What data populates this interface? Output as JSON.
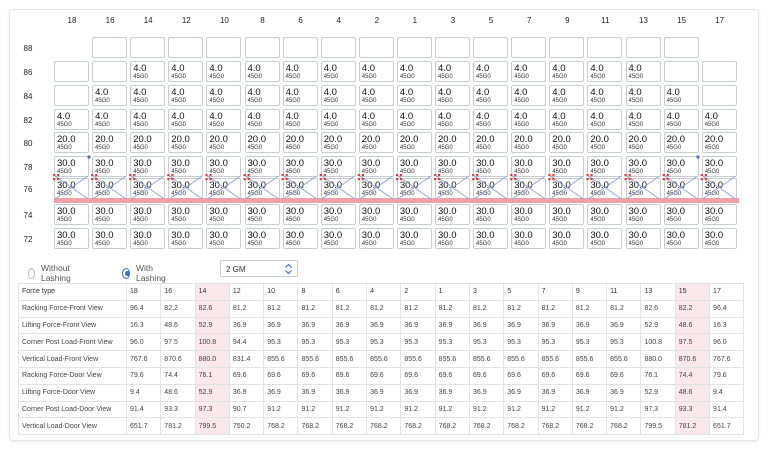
{
  "columns": [
    "18",
    "16",
    "14",
    "12",
    "10",
    "8",
    "6",
    "4",
    "2",
    "1",
    "3",
    "5",
    "7",
    "9",
    "11",
    "13",
    "15",
    "17"
  ],
  "tiers": [
    {
      "label": "88",
      "cells": [
        null,
        "",
        "",
        "",
        "",
        "",
        "",
        "",
        "",
        "",
        "",
        "",
        "",
        "",
        "",
        "",
        "",
        null
      ]
    },
    {
      "label": "86",
      "cells": [
        "",
        "",
        {
          "w": "4.0",
          "c": "45G0"
        },
        {
          "w": "4.0",
          "c": "45G0"
        },
        {
          "w": "4.0",
          "c": "45G0"
        },
        {
          "w": "4.0",
          "c": "45G0"
        },
        {
          "w": "4.0",
          "c": "45G0"
        },
        {
          "w": "4.0",
          "c": "45G0"
        },
        {
          "w": "4.0",
          "c": "45G0"
        },
        {
          "w": "4.0",
          "c": "45G0"
        },
        {
          "w": "4.0",
          "c": "45G0"
        },
        {
          "w": "4.0",
          "c": "45G0"
        },
        {
          "w": "4.0",
          "c": "45G0"
        },
        {
          "w": "4.0",
          "c": "45G0"
        },
        {
          "w": "4.0",
          "c": "45G0"
        },
        {
          "w": "4.0",
          "c": "45G0"
        },
        "",
        ""
      ]
    },
    {
      "label": "84",
      "cells": [
        "",
        {
          "w": "4.0",
          "c": "45G0"
        },
        {
          "w": "4.0",
          "c": "45G0"
        },
        {
          "w": "4.0",
          "c": "45G0"
        },
        {
          "w": "4.0",
          "c": "45G0"
        },
        {
          "w": "4.0",
          "c": "45G0"
        },
        {
          "w": "4.0",
          "c": "45G0"
        },
        {
          "w": "4.0",
          "c": "45G0"
        },
        {
          "w": "4.0",
          "c": "45G0"
        },
        {
          "w": "4.0",
          "c": "45G0"
        },
        {
          "w": "4.0",
          "c": "45G0"
        },
        {
          "w": "4.0",
          "c": "45G0"
        },
        {
          "w": "4.0",
          "c": "45G0"
        },
        {
          "w": "4.0",
          "c": "45G0"
        },
        {
          "w": "4.0",
          "c": "45G0"
        },
        {
          "w": "4.0",
          "c": "45G0"
        },
        {
          "w": "4.0",
          "c": "45G0"
        },
        ""
      ]
    },
    {
      "label": "82",
      "cells": [
        {
          "w": "4.0",
          "c": "45G0"
        },
        {
          "w": "4.0",
          "c": "45G0"
        },
        {
          "w": "4.0",
          "c": "45G0"
        },
        {
          "w": "4.0",
          "c": "45G0"
        },
        {
          "w": "4.0",
          "c": "45G0"
        },
        {
          "w": "4.0",
          "c": "45G0"
        },
        {
          "w": "4.0",
          "c": "45G0"
        },
        {
          "w": "4.0",
          "c": "45G0"
        },
        {
          "w": "4.0",
          "c": "45G0"
        },
        {
          "w": "4.0",
          "c": "45G0"
        },
        {
          "w": "4.0",
          "c": "45G0"
        },
        {
          "w": "4.0",
          "c": "45G0"
        },
        {
          "w": "4.0",
          "c": "45G0"
        },
        {
          "w": "4.0",
          "c": "45G0"
        },
        {
          "w": "4.0",
          "c": "45G0"
        },
        {
          "w": "4.0",
          "c": "45G0"
        },
        {
          "w": "4.0",
          "c": "45G0"
        },
        {
          "w": "4.0",
          "c": "45G0"
        }
      ]
    },
    {
      "label": "80",
      "cells": [
        {
          "w": "20.0",
          "c": "45G0"
        },
        {
          "w": "20.0",
          "c": "45G0"
        },
        {
          "w": "20.0",
          "c": "45G0"
        },
        {
          "w": "20.0",
          "c": "45G0"
        },
        {
          "w": "20.0",
          "c": "45G0"
        },
        {
          "w": "20.0",
          "c": "45G0"
        },
        {
          "w": "20.0",
          "c": "45G0"
        },
        {
          "w": "20.0",
          "c": "45G0"
        },
        {
          "w": "20.0",
          "c": "45G0"
        },
        {
          "w": "20.0",
          "c": "45G0"
        },
        {
          "w": "20.0",
          "c": "45G0"
        },
        {
          "w": "20.0",
          "c": "45G0"
        },
        {
          "w": "20.0",
          "c": "45G0"
        },
        {
          "w": "20.0",
          "c": "45G0"
        },
        {
          "w": "20.0",
          "c": "45G0"
        },
        {
          "w": "20.0",
          "c": "45G0"
        },
        {
          "w": "20.0",
          "c": "45G0"
        },
        {
          "w": "20.0",
          "c": "45G0"
        }
      ]
    },
    {
      "label": "78",
      "cells": [
        {
          "w": "30.0",
          "c": "45G0"
        },
        {
          "w": "30.0",
          "c": "45G0"
        },
        {
          "w": "30.0",
          "c": "45G0"
        },
        {
          "w": "30.0",
          "c": "45G0"
        },
        {
          "w": "30.0",
          "c": "45G0"
        },
        {
          "w": "30.0",
          "c": "45G0"
        },
        {
          "w": "30.0",
          "c": "45G0"
        },
        {
          "w": "30.0",
          "c": "45G0"
        },
        {
          "w": "30.0",
          "c": "45G0"
        },
        {
          "w": "30.0",
          "c": "45G0"
        },
        {
          "w": "30.0",
          "c": "45G0"
        },
        {
          "w": "30.0",
          "c": "45G0"
        },
        {
          "w": "30.0",
          "c": "45G0"
        },
        {
          "w": "30.0",
          "c": "45G0"
        },
        {
          "w": "30.0",
          "c": "45G0"
        },
        {
          "w": "30.0",
          "c": "45G0"
        },
        {
          "w": "30.0",
          "c": "45G0"
        },
        {
          "w": "30.0",
          "c": "45G0"
        }
      ]
    },
    {
      "label": "76",
      "cells": [
        {
          "w": "30.0",
          "c": "45G0"
        },
        {
          "w": "30.0",
          "c": "45G0"
        },
        {
          "w": "30.0",
          "c": "45G0"
        },
        {
          "w": "30.0",
          "c": "45G0"
        },
        {
          "w": "30.0",
          "c": "45G0"
        },
        {
          "w": "30.0",
          "c": "45G0"
        },
        {
          "w": "30.0",
          "c": "45G0"
        },
        {
          "w": "30.0",
          "c": "45G0"
        },
        {
          "w": "30.0",
          "c": "45G0"
        },
        {
          "w": "30.0",
          "c": "45G0"
        },
        {
          "w": "30.0",
          "c": "45G0"
        },
        {
          "w": "30.0",
          "c": "45G0"
        },
        {
          "w": "30.0",
          "c": "45G0"
        },
        {
          "w": "30.0",
          "c": "45G0"
        },
        {
          "w": "30.0",
          "c": "45G0"
        },
        {
          "w": "30.0",
          "c": "45G0"
        },
        {
          "w": "30.0",
          "c": "45G0"
        },
        {
          "w": "30.0",
          "c": "45G0"
        }
      ]
    },
    {
      "label": "74",
      "cells": [
        {
          "w": "30.0",
          "c": "45G0"
        },
        {
          "w": "30.0",
          "c": "45G0"
        },
        {
          "w": "30.0",
          "c": "45G0"
        },
        {
          "w": "30.0",
          "c": "45G0"
        },
        {
          "w": "30.0",
          "c": "45G0"
        },
        {
          "w": "30.0",
          "c": "45G0"
        },
        {
          "w": "30.0",
          "c": "45G0"
        },
        {
          "w": "30.0",
          "c": "45G0"
        },
        {
          "w": "30.0",
          "c": "45G0"
        },
        {
          "w": "30.0",
          "c": "45G0"
        },
        {
          "w": "30.0",
          "c": "45G0"
        },
        {
          "w": "30.0",
          "c": "45G0"
        },
        {
          "w": "30.0",
          "c": "45G0"
        },
        {
          "w": "30.0",
          "c": "45G0"
        },
        {
          "w": "30.0",
          "c": "45G0"
        },
        {
          "w": "30.0",
          "c": "45G0"
        },
        {
          "w": "30.0",
          "c": "45G0"
        },
        {
          "w": "30.0",
          "c": "45G0"
        }
      ]
    },
    {
      "label": "72",
      "cells": [
        {
          "w": "30.0",
          "c": "45G0"
        },
        {
          "w": "30.0",
          "c": "45G0"
        },
        {
          "w": "30.0",
          "c": "45G0"
        },
        {
          "w": "30.0",
          "c": "45G0"
        },
        {
          "w": "30.0",
          "c": "45G0"
        },
        {
          "w": "30.0",
          "c": "45G0"
        },
        {
          "w": "30.0",
          "c": "45G0"
        },
        {
          "w": "30.0",
          "c": "45G0"
        },
        {
          "w": "30.0",
          "c": "45G0"
        },
        {
          "w": "30.0",
          "c": "45G0"
        },
        {
          "w": "30.0",
          "c": "45G0"
        },
        {
          "w": "30.0",
          "c": "45G0"
        },
        {
          "w": "30.0",
          "c": "45G0"
        },
        {
          "w": "30.0",
          "c": "45G0"
        },
        {
          "w": "30.0",
          "c": "45G0"
        },
        {
          "w": "30.0",
          "c": "45G0"
        },
        {
          "w": "30.0",
          "c": "45G0"
        },
        {
          "w": "30.0",
          "c": "45G0"
        }
      ]
    }
  ],
  "lashing_colors": {
    "bar": "#f0a0a8",
    "rod": "#8fa6d8",
    "marker": "#e23a3a",
    "accent": "#3b73c4",
    "highlight": "#fbe8ea"
  },
  "controls": {
    "without_lashing_label": "Without Lashing",
    "with_lashing_label": "With Lashing",
    "selected_mode": "with_lashing",
    "gm_value": "2 GM"
  },
  "force_table": {
    "header_label": "Force type",
    "rows": [
      {
        "label": "Racking Force-Front View",
        "values": [
          "96.4",
          "82.2",
          "82.6",
          "81.2",
          "81.2",
          "81.2",
          "81.2",
          "81.2",
          "81.2",
          "81.2",
          "81.2",
          "81.2",
          "81.2",
          "81.2",
          "81.2",
          "82.6",
          "82.2",
          "96.4"
        ]
      },
      {
        "label": "Lifting Force-Front View",
        "values": [
          "16.3",
          "48.6",
          "52.9",
          "36.9",
          "36.9",
          "36.9",
          "36.9",
          "36.9",
          "36.9",
          "36.9",
          "36.9",
          "36.9",
          "36.9",
          "36.9",
          "36.9",
          "52.9",
          "48.6",
          "16.3"
        ]
      },
      {
        "label": "Corner Post Load-Front View",
        "values": [
          "96.0",
          "97.5",
          "100.8",
          "94.4",
          "95.3",
          "95.3",
          "95.3",
          "95.3",
          "95.3",
          "95.3",
          "95.3",
          "95.3",
          "95.3",
          "95.3",
          "95.3",
          "100.8",
          "97.5",
          "96.0"
        ]
      },
      {
        "label": "Vertical Load-Front View",
        "values": [
          "767.6",
          "870.6",
          "880.0",
          "831.4",
          "855.6",
          "855.6",
          "855.6",
          "855.6",
          "855.6",
          "855.6",
          "855.6",
          "855.6",
          "855.6",
          "855.6",
          "855.6",
          "880.0",
          "870.6",
          "767.6"
        ]
      },
      {
        "label": "Racking Force-Door View",
        "values": [
          "79.6",
          "74.4",
          "76.1",
          "69.6",
          "69.6",
          "69.6",
          "69.6",
          "69.6",
          "69.6",
          "69.6",
          "69.6",
          "69.6",
          "69.6",
          "69.6",
          "69.6",
          "76.1",
          "74.4",
          "79.6"
        ]
      },
      {
        "label": "Lifting Force-Door View",
        "values": [
          "9.4",
          "48.6",
          "52.9",
          "36.9",
          "36.9",
          "36.9",
          "36.9",
          "36.9",
          "36.9",
          "36.9",
          "36.9",
          "36.9",
          "36.9",
          "36.9",
          "36.9",
          "52.9",
          "48.6",
          "9.4"
        ]
      },
      {
        "label": "Corner Post Load-Door View",
        "values": [
          "91.4",
          "93.3",
          "97.3",
          "90.7",
          "91.2",
          "91.2",
          "91.2",
          "91.2",
          "91.2",
          "91.2",
          "91.2",
          "91.2",
          "91.2",
          "91.2",
          "91.2",
          "97.3",
          "93.3",
          "91.4"
        ]
      },
      {
        "label": "Vertical Load-Door View",
        "values": [
          "651.7",
          "781.2",
          "799.5",
          "750.2",
          "768.2",
          "768.2",
          "768.2",
          "768.2",
          "768.2",
          "768.2",
          "768.2",
          "768.2",
          "768.2",
          "768.2",
          "768.2",
          "799.5",
          "781.2",
          "651.7"
        ]
      }
    ],
    "highlight_columns": [
      2,
      16
    ]
  }
}
